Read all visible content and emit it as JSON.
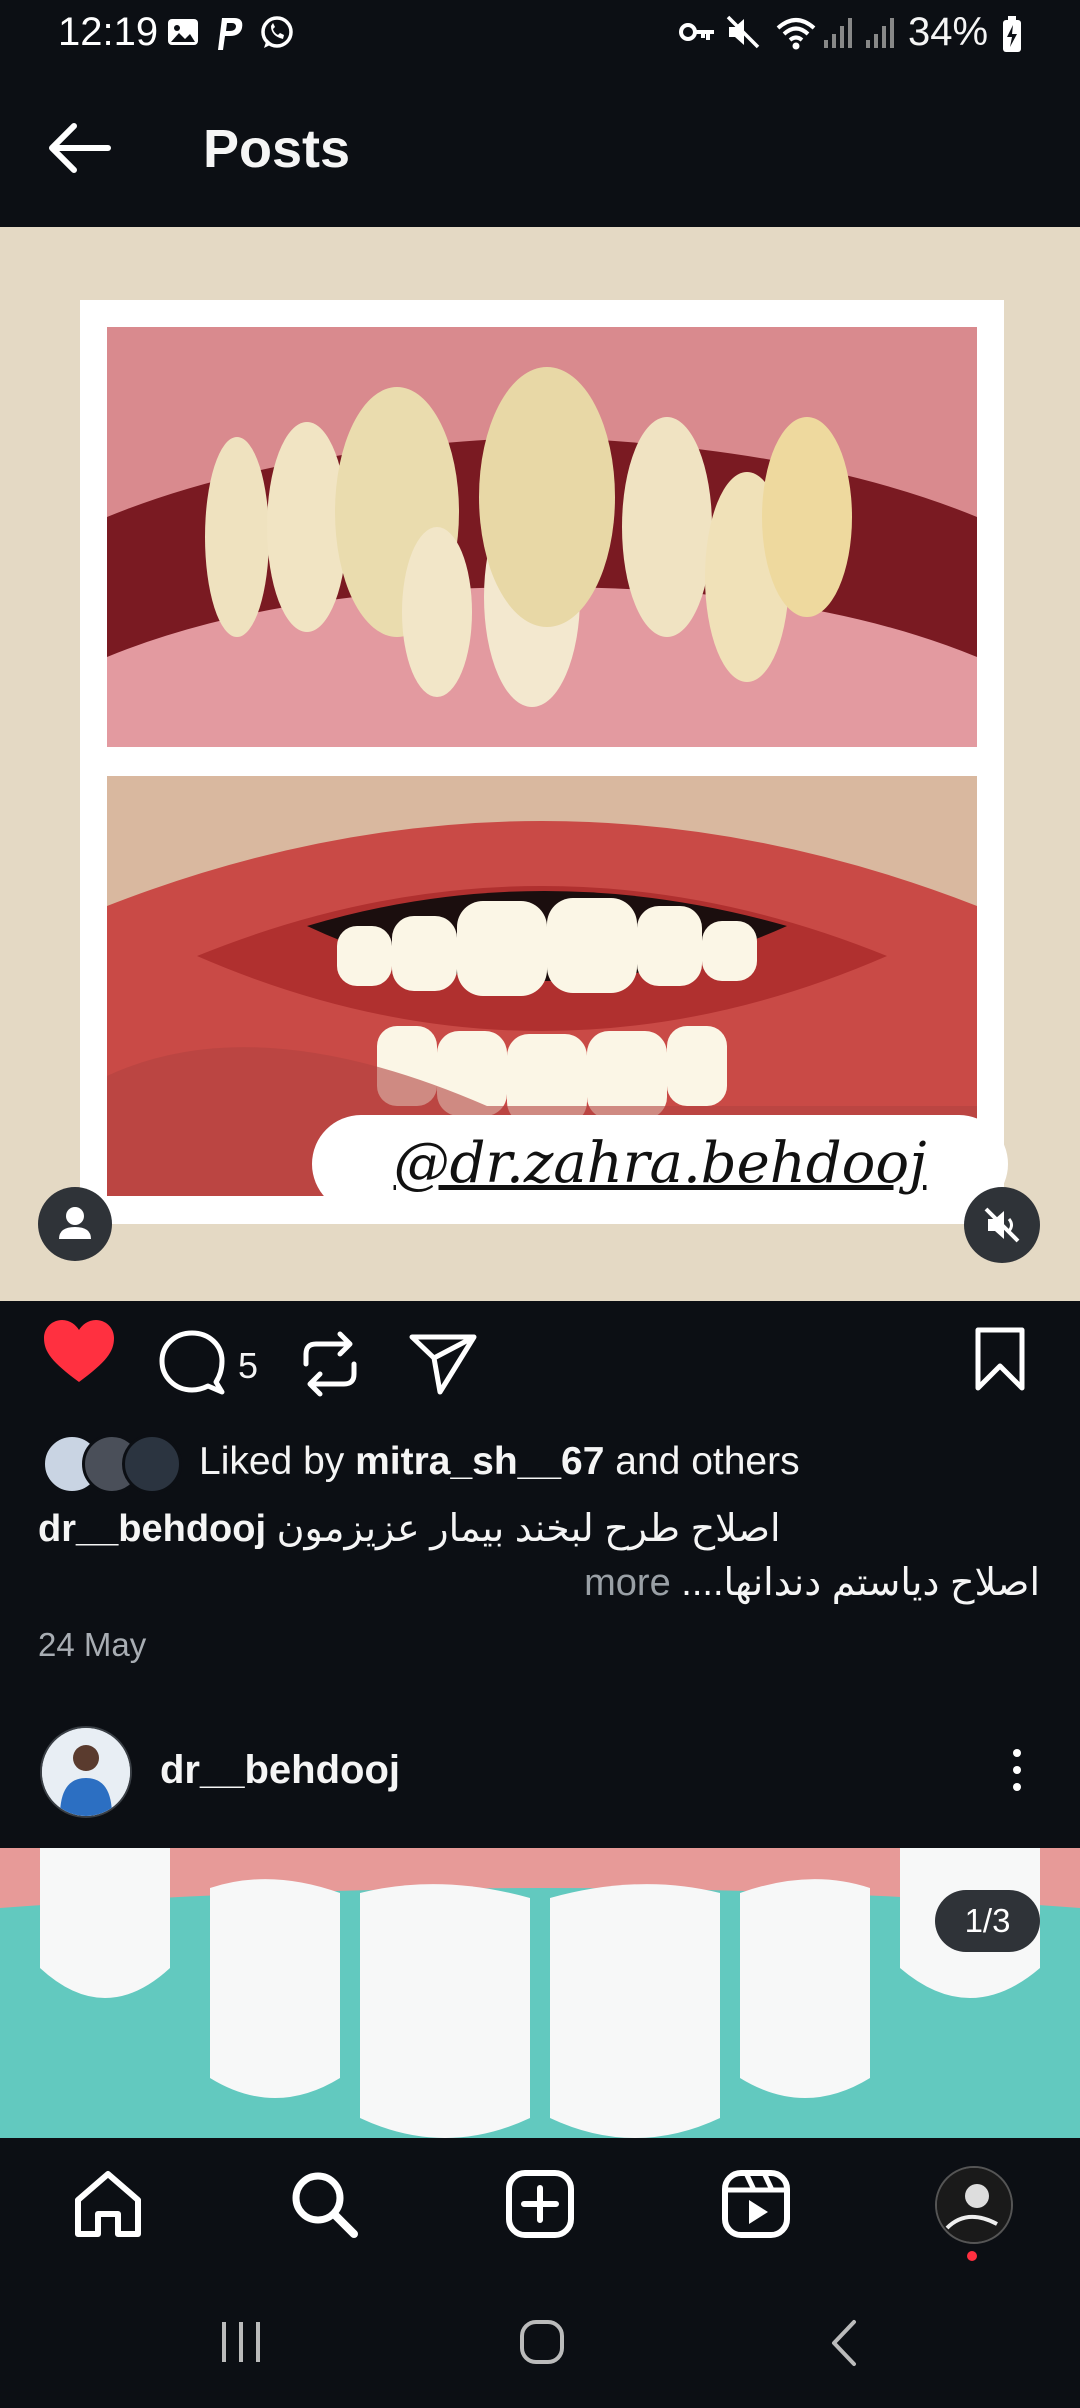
{
  "status_bar": {
    "time": "12:19",
    "battery": "34%",
    "icons": [
      "gallery-icon",
      "p-icon",
      "whatsapp-icon",
      "key-icon",
      "mute-icon",
      "wifi-icon",
      "signal-icon",
      "signal-icon",
      "battery-charging-icon"
    ]
  },
  "header": {
    "back_icon": "arrow-left-icon",
    "title": "Posts"
  },
  "post": {
    "watermark": "@dr.zahra.behdooj",
    "comment_count": "5",
    "liked_prefix": "Liked by",
    "liked_user": "mitra_sh__67",
    "liked_suffix": "and others",
    "caption_user": "dr__behdooj",
    "caption_line1": "اصلاح طرح لبخند بیمار عزیزمون",
    "caption_line2": "اصلاح دیاستم دندانها....",
    "more": "more",
    "date": "24 May",
    "liked": true,
    "like_color": "#ff3040"
  },
  "next_post": {
    "username": "dr__behdooj",
    "counter": "1/3"
  },
  "bottom_nav": [
    "home-icon",
    "search-icon",
    "create-icon",
    "reels-icon",
    "profile-avatar"
  ],
  "colors": {
    "background": "#0c0f14",
    "media_bg": "#e4d9c4",
    "notification_dot": "#ff3040"
  }
}
